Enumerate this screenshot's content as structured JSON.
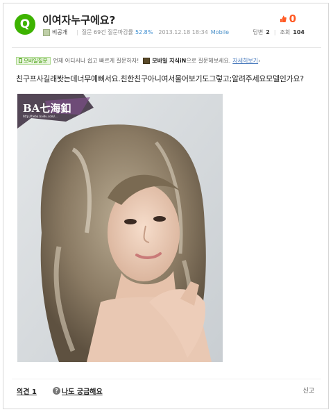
{
  "question": {
    "icon_letter": "Q",
    "title": "이여자누구에요?",
    "author": "비공개",
    "rate_label": "질문 69건 질문마감률",
    "rate_value": "52.8%",
    "date": "2013.12.18 18:34",
    "device": "Mobile",
    "likes": "0",
    "answers_label": "답변",
    "answers_count": "2",
    "views_label": "조회",
    "views_count": "104"
  },
  "mobile_banner": {
    "tag": "모바일질문",
    "text": "언제 어디서나 쉽고 빠르게 질문하자!",
    "kin_bold": "모바일 지식iN",
    "kin_text": "으로 질문해보세요.",
    "more": "자세히보기",
    "more_arrow": "›"
  },
  "content": {
    "text": "친구프사길래봣는데너무예뻐서요.친한친구아니여서물어보기도그렇고;알려주세요모델인가요?",
    "watermark": "BA七海釦",
    "watermark_sub": "http://tieba.baidu.com/..."
  },
  "footer": {
    "opinion": "의견 1",
    "curious": "나도 궁금해요",
    "report": "신고"
  },
  "colors": {
    "q_green": "#3db300",
    "like_orange": "#ff5a24",
    "link_blue": "#4a7bbd",
    "rate_blue": "#3d8ed1"
  },
  "icons": [
    "question-q-icon",
    "avatar-icon",
    "thumb-up-icon",
    "mobile-phone-icon",
    "kin-icon",
    "question-circle-icon"
  ]
}
